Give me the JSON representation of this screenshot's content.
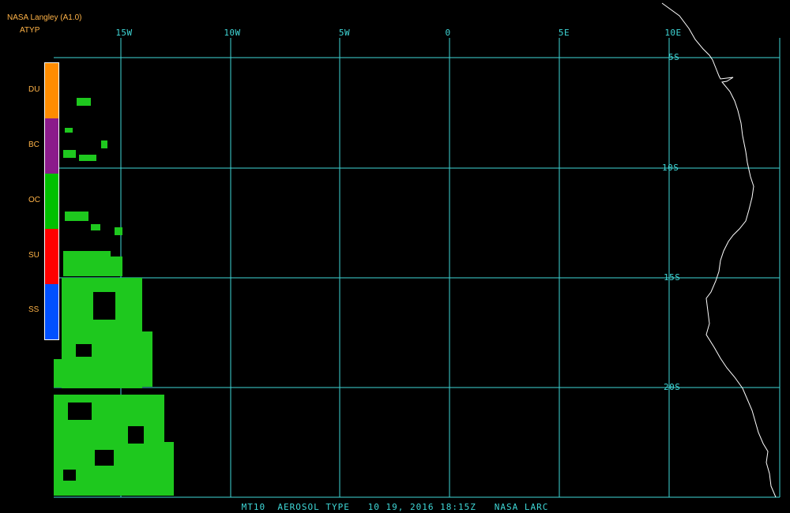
{
  "header": {
    "line1": "NASA Langley (A1.0)",
    "line2": "ATYP"
  },
  "longitude_labels": [
    "15W",
    "10W",
    "5W",
    "0",
    "5E",
    "10E"
  ],
  "latitude_labels": [
    "5S",
    "10S",
    "15S",
    "20S"
  ],
  "legend": {
    "items": [
      {
        "label": "DU",
        "color": "#ff8c00"
      },
      {
        "label": "BC",
        "color": "#8b1a8b"
      },
      {
        "label": "OC",
        "color": "#00c000"
      },
      {
        "label": "SU",
        "color": "#ff0000"
      },
      {
        "label": "SS",
        "color": "#0050ff"
      }
    ]
  },
  "footer": "MT10  AEROSOL TYPE   10 19, 2016 18:15Z   NASA LARC",
  "colors": {
    "grid": "#3fd7d7",
    "coast": "#ffffff",
    "aerosol": "#1ec81e",
    "text": "#ffb347"
  }
}
